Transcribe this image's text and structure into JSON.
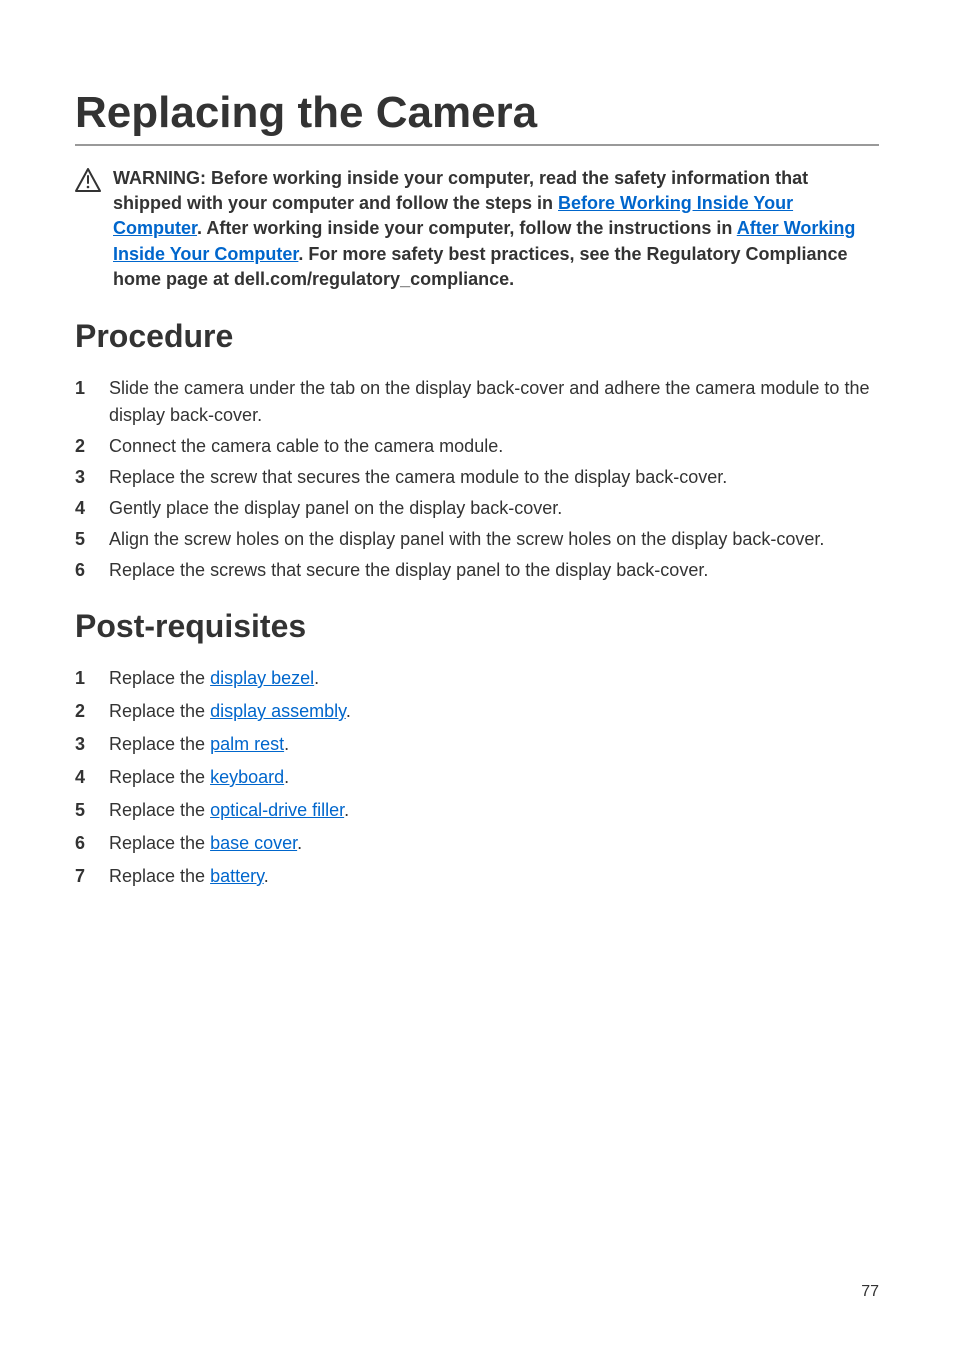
{
  "title": "Replacing the Camera",
  "warning": {
    "pre": "WARNING: Before working inside your computer, read the safety information that shipped with your computer and follow the steps in ",
    "link1": "Before Working Inside Your Computer",
    "mid1": ". After working inside your computer, follow the instructions in ",
    "link2": "After Working Inside Your Computer",
    "post": ". For more safety best practices, see the Regulatory Compliance home page at dell.com/regulatory_compliance."
  },
  "sections": {
    "procedure_title": "Procedure",
    "procedure": [
      "Slide the camera under the tab on the display back-cover and adhere the camera module to the display back-cover.",
      "Connect the camera cable to the camera module.",
      "Replace the screw that secures the camera module to the display back-cover.",
      "Gently place the display panel on the display back-cover.",
      "Align the screw holes on the display panel with the screw holes on the display back-cover.",
      "Replace the screws that secure the display panel to the display back-cover."
    ],
    "postreq_title": "Post-requisites",
    "postreq": [
      {
        "pre": "Replace the ",
        "link": "display bezel",
        "post": "."
      },
      {
        "pre": "Replace the ",
        "link": "display assembly",
        "post": "."
      },
      {
        "pre": "Replace the ",
        "link": "palm rest",
        "post": "."
      },
      {
        "pre": "Replace the ",
        "link": "keyboard",
        "post": "."
      },
      {
        "pre": "Replace the ",
        "link": "optical-drive filler",
        "post": "."
      },
      {
        "pre": "Replace the ",
        "link": "base cover",
        "post": "."
      },
      {
        "pre": "Replace the ",
        "link": "battery",
        "post": "."
      }
    ]
  },
  "page_number": "77"
}
